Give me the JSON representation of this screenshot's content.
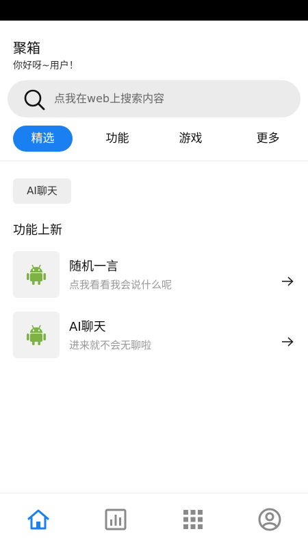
{
  "header": {
    "title": "聚箱",
    "subtitle": "你好呀~用户！"
  },
  "search": {
    "placeholder": "点我在web上搜索内容",
    "icon": "search-icon"
  },
  "tabs": [
    {
      "label": "精选",
      "active": true
    },
    {
      "label": "功能",
      "active": false
    },
    {
      "label": "游戏",
      "active": false
    },
    {
      "label": "更多",
      "active": false
    }
  ],
  "chip": {
    "label": "AI聊天"
  },
  "section": {
    "title": "功能上新"
  },
  "features": [
    {
      "title": "随机一言",
      "desc": "点我看看我会说什么呢",
      "icon": "android-icon"
    },
    {
      "title": "AI聊天",
      "desc": "进来就不会无聊啦",
      "icon": "android-icon"
    }
  ],
  "bottom_nav": [
    {
      "icon": "home-icon",
      "active": true
    },
    {
      "icon": "chart-icon",
      "active": false
    },
    {
      "icon": "grid-icon",
      "active": false
    },
    {
      "icon": "profile-icon",
      "active": false
    }
  ],
  "colors": {
    "accent": "#1a7ff0",
    "inactive_icon": "#8a8a8a",
    "android_green": "#7cb342"
  }
}
